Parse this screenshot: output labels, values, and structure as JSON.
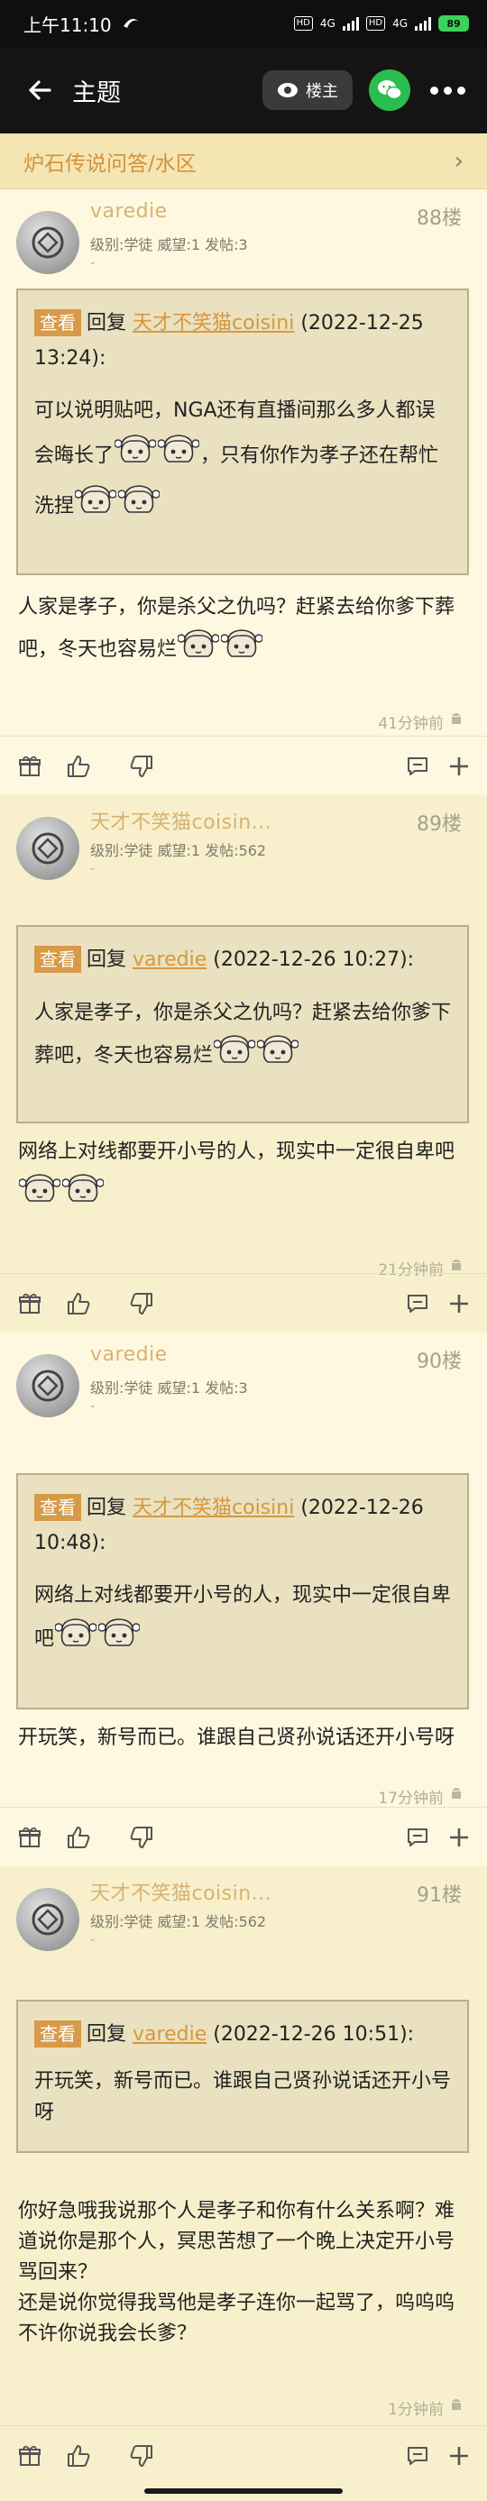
{
  "status": {
    "time": "上午11:10",
    "net1": "4G",
    "net2": "4G",
    "battery": "89"
  },
  "header": {
    "title": "主题",
    "owner_label": "楼主"
  },
  "forum": {
    "name": "炉石传说问答/水区"
  },
  "posts": [
    {
      "username": "varedie",
      "meta": "级别:学徒 威望:1 发帖:3",
      "dash": "-",
      "floor": "88楼",
      "quote": {
        "tag": "查看",
        "reply_word": "回复",
        "link": "天才不笑猫coisini",
        "date": "(2022-12-25 13:24):",
        "text_a": "可以说明贴吧，NGA还有直播间那么多人都误会晦长了",
        "text_b": "，只有你作为孝子还在帮忙洗捏"
      },
      "body": "人家是孝子，你是杀父之仇吗？赶紧去给你爹下葬吧，冬天也容易烂",
      "time": "41分钟前"
    },
    {
      "username": "天才不笑猫coisin...",
      "meta": "级别:学徒 威望:1 发帖:562",
      "dash": "-",
      "floor": "89楼",
      "quote": {
        "tag": "查看",
        "reply_word": "回复",
        "link": "varedie",
        "date": "(2022-12-26 10:27):",
        "text": "人家是孝子，你是杀父之仇吗？赶紧去给你爹下葬吧，冬天也容易烂"
      },
      "body": "网络上对线都要开小号的人，现实中一定很自卑吧",
      "time": "21分钟前"
    },
    {
      "username": "varedie",
      "meta": "级别:学徒 威望:1 发帖:3",
      "dash": "-",
      "floor": "90楼",
      "quote": {
        "tag": "查看",
        "reply_word": "回复",
        "link": "天才不笑猫coisini",
        "date": "(2022-12-26 10:48):",
        "text": "网络上对线都要开小号的人，现实中一定很自卑吧"
      },
      "body": "开玩笑，新号而已。谁跟自己贤孙说话还开小号呀",
      "time": "17分钟前"
    },
    {
      "username": "天才不笑猫coisin...",
      "meta": "级别:学徒 威望:1 发帖:562",
      "dash": "-",
      "floor": "91楼",
      "quote": {
        "tag": "查看",
        "reply_word": "回复",
        "link": "varedie",
        "date": "(2022-12-26 10:51):",
        "text": "开玩笑，新号而已。谁跟自己贤孙说话还开小号呀"
      },
      "body": "你好急哦我说那个人是孝子和你有什么关系啊？难道说你是那个人，冥思苦想了一个晚上决定开小号骂回来？\n还是说你觉得我骂他是孝子连你一起骂了，呜呜呜不许你说我会长爹？",
      "time": "1分钟前"
    }
  ],
  "icons": [
    "back-arrow-icon",
    "eye-icon",
    "wechat-icon",
    "more-icon",
    "gift-icon",
    "like-icon",
    "dislike-icon",
    "comment-icon",
    "plus-icon",
    "android-icon",
    "anime-sticker-icon"
  ]
}
